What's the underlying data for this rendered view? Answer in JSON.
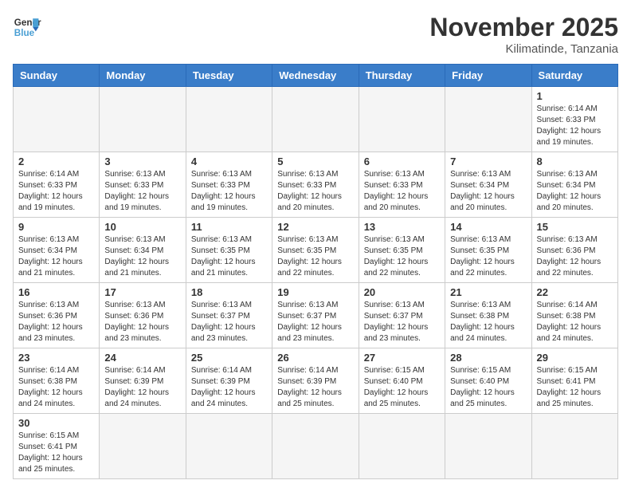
{
  "logo": {
    "text_general": "General",
    "text_blue": "Blue"
  },
  "title": {
    "month_year": "November 2025",
    "location": "Kilimatinde, Tanzania"
  },
  "days_of_week": [
    "Sunday",
    "Monday",
    "Tuesday",
    "Wednesday",
    "Thursday",
    "Friday",
    "Saturday"
  ],
  "weeks": [
    [
      {
        "day": "",
        "info": "",
        "empty": true
      },
      {
        "day": "",
        "info": "",
        "empty": true
      },
      {
        "day": "",
        "info": "",
        "empty": true
      },
      {
        "day": "",
        "info": "",
        "empty": true
      },
      {
        "day": "",
        "info": "",
        "empty": true
      },
      {
        "day": "",
        "info": "",
        "empty": true
      },
      {
        "day": "1",
        "info": "Sunrise: 6:14 AM\nSunset: 6:33 PM\nDaylight: 12 hours and 19 minutes.",
        "empty": false
      }
    ],
    [
      {
        "day": "2",
        "info": "Sunrise: 6:14 AM\nSunset: 6:33 PM\nDaylight: 12 hours and 19 minutes.",
        "empty": false
      },
      {
        "day": "3",
        "info": "Sunrise: 6:13 AM\nSunset: 6:33 PM\nDaylight: 12 hours and 19 minutes.",
        "empty": false
      },
      {
        "day": "4",
        "info": "Sunrise: 6:13 AM\nSunset: 6:33 PM\nDaylight: 12 hours and 19 minutes.",
        "empty": false
      },
      {
        "day": "5",
        "info": "Sunrise: 6:13 AM\nSunset: 6:33 PM\nDaylight: 12 hours and 20 minutes.",
        "empty": false
      },
      {
        "day": "6",
        "info": "Sunrise: 6:13 AM\nSunset: 6:33 PM\nDaylight: 12 hours and 20 minutes.",
        "empty": false
      },
      {
        "day": "7",
        "info": "Sunrise: 6:13 AM\nSunset: 6:34 PM\nDaylight: 12 hours and 20 minutes.",
        "empty": false
      },
      {
        "day": "8",
        "info": "Sunrise: 6:13 AM\nSunset: 6:34 PM\nDaylight: 12 hours and 20 minutes.",
        "empty": false
      }
    ],
    [
      {
        "day": "9",
        "info": "Sunrise: 6:13 AM\nSunset: 6:34 PM\nDaylight: 12 hours and 21 minutes.",
        "empty": false
      },
      {
        "day": "10",
        "info": "Sunrise: 6:13 AM\nSunset: 6:34 PM\nDaylight: 12 hours and 21 minutes.",
        "empty": false
      },
      {
        "day": "11",
        "info": "Sunrise: 6:13 AM\nSunset: 6:35 PM\nDaylight: 12 hours and 21 minutes.",
        "empty": false
      },
      {
        "day": "12",
        "info": "Sunrise: 6:13 AM\nSunset: 6:35 PM\nDaylight: 12 hours and 22 minutes.",
        "empty": false
      },
      {
        "day": "13",
        "info": "Sunrise: 6:13 AM\nSunset: 6:35 PM\nDaylight: 12 hours and 22 minutes.",
        "empty": false
      },
      {
        "day": "14",
        "info": "Sunrise: 6:13 AM\nSunset: 6:35 PM\nDaylight: 12 hours and 22 minutes.",
        "empty": false
      },
      {
        "day": "15",
        "info": "Sunrise: 6:13 AM\nSunset: 6:36 PM\nDaylight: 12 hours and 22 minutes.",
        "empty": false
      }
    ],
    [
      {
        "day": "16",
        "info": "Sunrise: 6:13 AM\nSunset: 6:36 PM\nDaylight: 12 hours and 23 minutes.",
        "empty": false
      },
      {
        "day": "17",
        "info": "Sunrise: 6:13 AM\nSunset: 6:36 PM\nDaylight: 12 hours and 23 minutes.",
        "empty": false
      },
      {
        "day": "18",
        "info": "Sunrise: 6:13 AM\nSunset: 6:37 PM\nDaylight: 12 hours and 23 minutes.",
        "empty": false
      },
      {
        "day": "19",
        "info": "Sunrise: 6:13 AM\nSunset: 6:37 PM\nDaylight: 12 hours and 23 minutes.",
        "empty": false
      },
      {
        "day": "20",
        "info": "Sunrise: 6:13 AM\nSunset: 6:37 PM\nDaylight: 12 hours and 23 minutes.",
        "empty": false
      },
      {
        "day": "21",
        "info": "Sunrise: 6:13 AM\nSunset: 6:38 PM\nDaylight: 12 hours and 24 minutes.",
        "empty": false
      },
      {
        "day": "22",
        "info": "Sunrise: 6:14 AM\nSunset: 6:38 PM\nDaylight: 12 hours and 24 minutes.",
        "empty": false
      }
    ],
    [
      {
        "day": "23",
        "info": "Sunrise: 6:14 AM\nSunset: 6:38 PM\nDaylight: 12 hours and 24 minutes.",
        "empty": false
      },
      {
        "day": "24",
        "info": "Sunrise: 6:14 AM\nSunset: 6:39 PM\nDaylight: 12 hours and 24 minutes.",
        "empty": false
      },
      {
        "day": "25",
        "info": "Sunrise: 6:14 AM\nSunset: 6:39 PM\nDaylight: 12 hours and 24 minutes.",
        "empty": false
      },
      {
        "day": "26",
        "info": "Sunrise: 6:14 AM\nSunset: 6:39 PM\nDaylight: 12 hours and 25 minutes.",
        "empty": false
      },
      {
        "day": "27",
        "info": "Sunrise: 6:15 AM\nSunset: 6:40 PM\nDaylight: 12 hours and 25 minutes.",
        "empty": false
      },
      {
        "day": "28",
        "info": "Sunrise: 6:15 AM\nSunset: 6:40 PM\nDaylight: 12 hours and 25 minutes.",
        "empty": false
      },
      {
        "day": "29",
        "info": "Sunrise: 6:15 AM\nSunset: 6:41 PM\nDaylight: 12 hours and 25 minutes.",
        "empty": false
      }
    ],
    [
      {
        "day": "30",
        "info": "Sunrise: 6:15 AM\nSunset: 6:41 PM\nDaylight: 12 hours and 25 minutes.",
        "empty": false
      },
      {
        "day": "",
        "info": "",
        "empty": true
      },
      {
        "day": "",
        "info": "",
        "empty": true
      },
      {
        "day": "",
        "info": "",
        "empty": true
      },
      {
        "day": "",
        "info": "",
        "empty": true
      },
      {
        "day": "",
        "info": "",
        "empty": true
      },
      {
        "day": "",
        "info": "",
        "empty": true
      }
    ]
  ]
}
